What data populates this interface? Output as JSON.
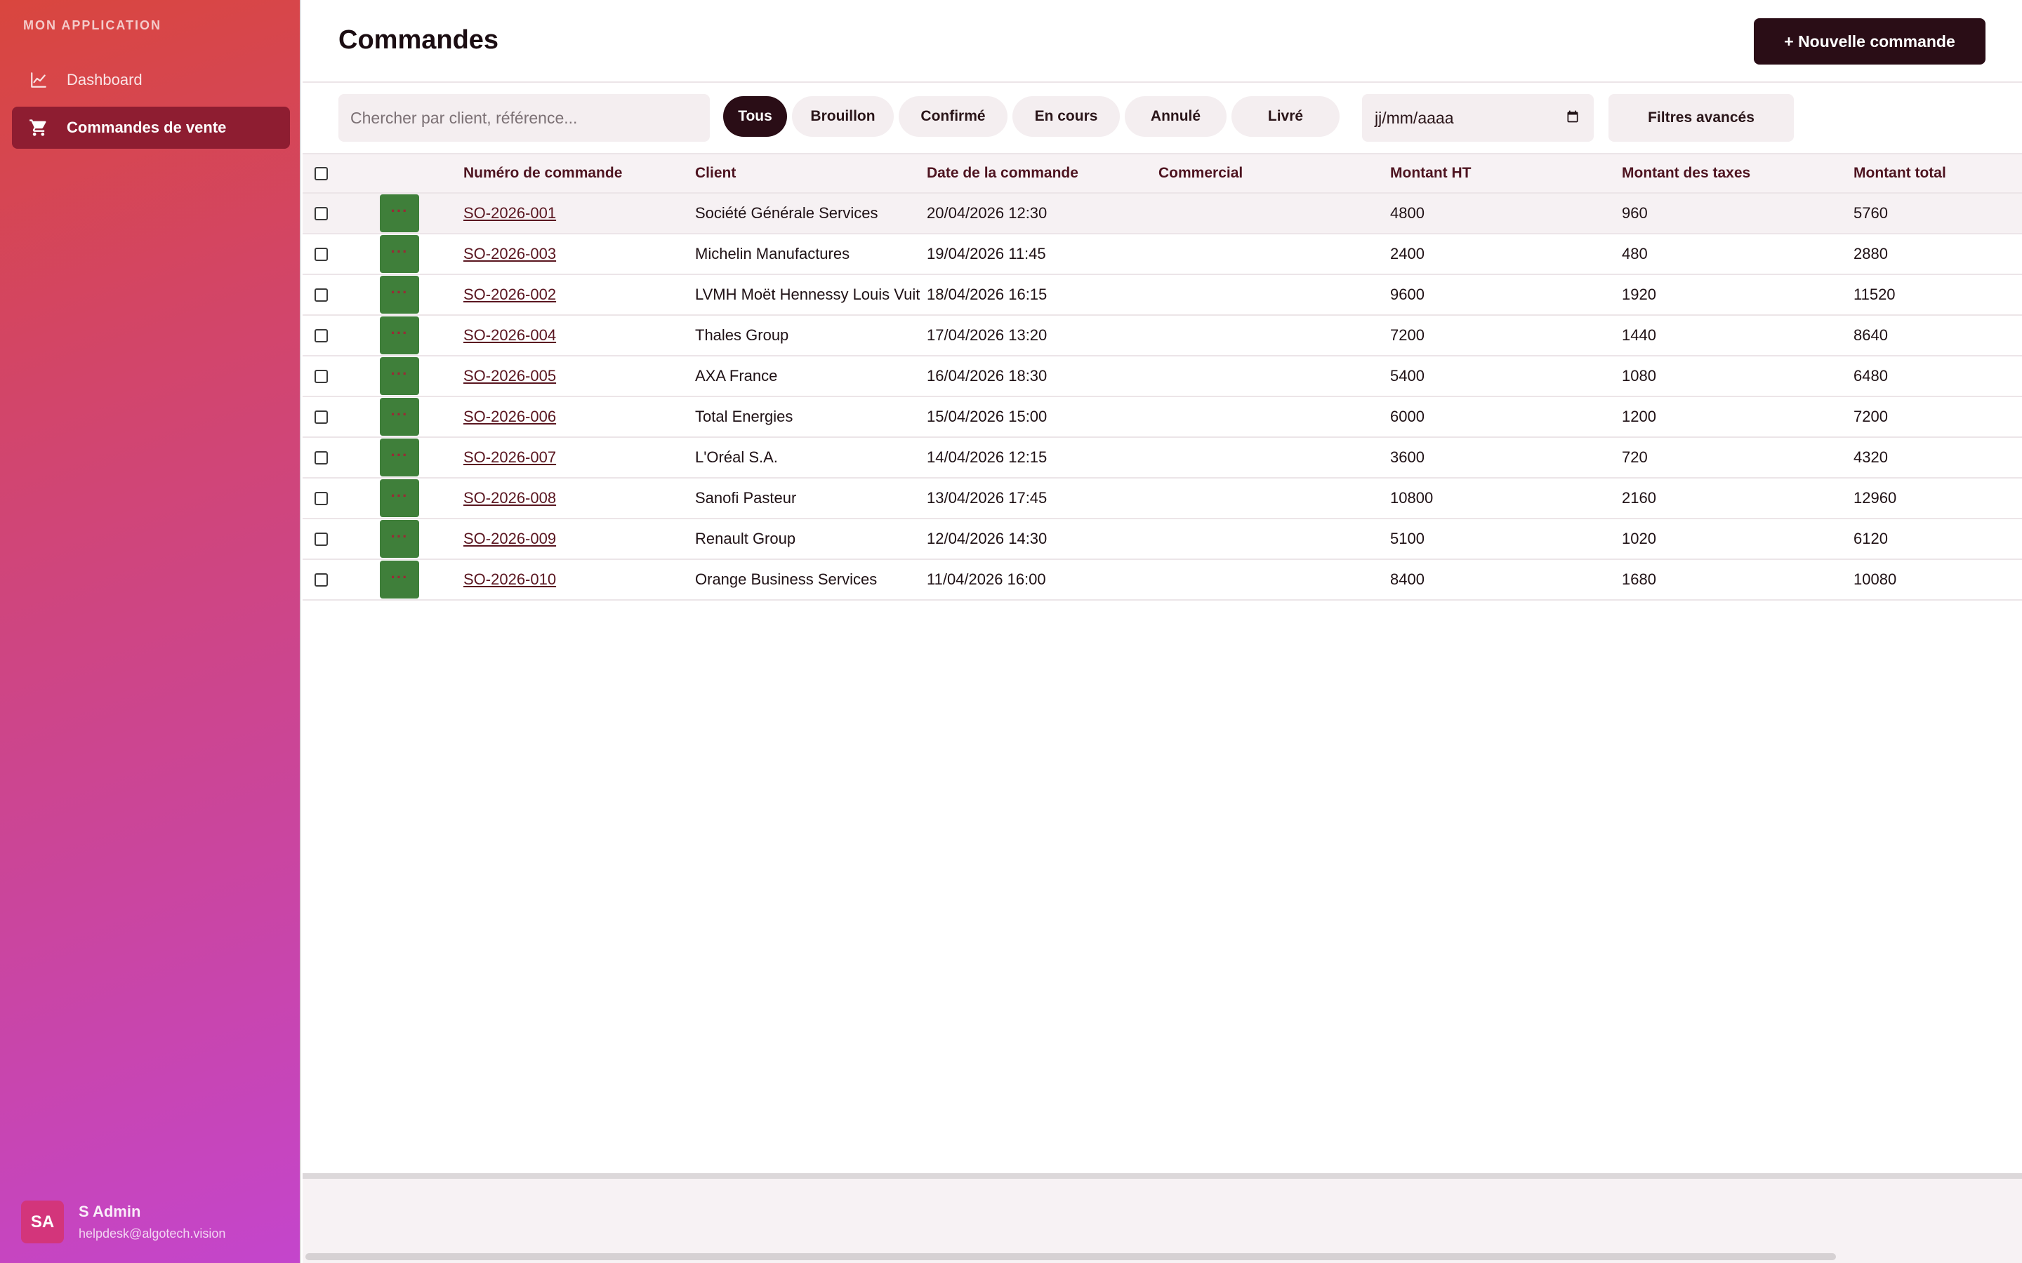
{
  "app": {
    "name": "MON APPLICATION"
  },
  "sidebar": {
    "items": [
      {
        "label": "Dashboard",
        "icon": "chart-line-icon",
        "active": false
      },
      {
        "label": "Commandes de vente",
        "icon": "cart-icon",
        "active": true
      }
    ],
    "user": {
      "initials": "SA",
      "name": "S Admin",
      "email": "helpdesk@algotech.vision"
    }
  },
  "header": {
    "title": "Commandes",
    "new_button": "+ Nouvelle commande"
  },
  "toolbar": {
    "search_placeholder": "Chercher par client, référence...",
    "filters": [
      "Tous",
      "Brouillon",
      "Confirmé",
      "En cours",
      "Annulé",
      "Livré"
    ],
    "active_filter": "Tous",
    "date_placeholder": "jj/mm/aaaa",
    "advanced_filters": "Filtres avancés"
  },
  "table": {
    "columns": [
      "Numéro de commande",
      "Client",
      "Date de la commande",
      "Commercial",
      "Montant HT",
      "Montant des taxes",
      "Montant total"
    ],
    "rows": [
      {
        "number": "SO-2026-001",
        "client": "Société Générale Services",
        "date": "20/04/2026 12:30",
        "commercial": "",
        "ht": "4800",
        "tax": "960",
        "total": "5760"
      },
      {
        "number": "SO-2026-003",
        "client": "Michelin Manufactures",
        "date": "19/04/2026 11:45",
        "commercial": "",
        "ht": "2400",
        "tax": "480",
        "total": "2880"
      },
      {
        "number": "SO-2026-002",
        "client": "LVMH Moët Hennessy Louis Vuitton",
        "date": "18/04/2026 16:15",
        "commercial": "",
        "ht": "9600",
        "tax": "1920",
        "total": "11520"
      },
      {
        "number": "SO-2026-004",
        "client": "Thales Group",
        "date": "17/04/2026 13:20",
        "commercial": "",
        "ht": "7200",
        "tax": "1440",
        "total": "8640"
      },
      {
        "number": "SO-2026-005",
        "client": "AXA France",
        "date": "16/04/2026 18:30",
        "commercial": "",
        "ht": "5400",
        "tax": "1080",
        "total": "6480"
      },
      {
        "number": "SO-2026-006",
        "client": "Total Energies",
        "date": "15/04/2026 15:00",
        "commercial": "",
        "ht": "6000",
        "tax": "1200",
        "total": "7200"
      },
      {
        "number": "SO-2026-007",
        "client": "L'Oréal S.A.",
        "date": "14/04/2026 12:15",
        "commercial": "",
        "ht": "3600",
        "tax": "720",
        "total": "4320"
      },
      {
        "number": "SO-2026-008",
        "client": "Sanofi Pasteur",
        "date": "13/04/2026 17:45",
        "commercial": "",
        "ht": "10800",
        "tax": "2160",
        "total": "12960"
      },
      {
        "number": "SO-2026-009",
        "client": "Renault Group",
        "date": "12/04/2026 14:30",
        "commercial": "",
        "ht": "5100",
        "tax": "1020",
        "total": "6120"
      },
      {
        "number": "SO-2026-010",
        "client": "Orange Business Services",
        "date": "11/04/2026 16:00",
        "commercial": "",
        "ht": "8400",
        "tax": "1680",
        "total": "10080"
      }
    ],
    "row_action_label": "···"
  },
  "colors": {
    "accent": "#2a0d16",
    "active_nav": "#8e1d31",
    "action_green": "#3f7f3a"
  }
}
